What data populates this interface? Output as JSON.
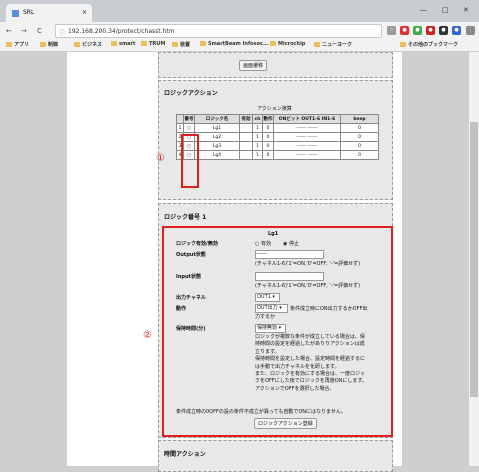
{
  "browser": {
    "tab_title": "SRL",
    "tab_close": "×",
    "url": "192.168.200.34/protect/chasst.htm",
    "window_controls": [
      "—",
      "□",
      "✕"
    ],
    "nav": [
      "←",
      "→",
      "C"
    ],
    "url_info": "ⓘ"
  },
  "bookmarks": [
    "アプリ",
    "制御",
    "ビジネス",
    "smart",
    "TRUM",
    "装置",
    "SmartBeam Infosoc...",
    "Microchip",
    "ニューヨーク"
  ],
  "bookmarks_right": "その他のブックマーク",
  "top_section": {
    "button": "画面遷移"
  },
  "logic_action": {
    "title": "ロジックアクション",
    "table_caption": "アクション演算",
    "headers": [
      "番号",
      "ロジック名",
      "有効",
      "ch",
      "動作",
      "ONビット OUT1-6 IN1-6",
      "keep"
    ],
    "rows": [
      {
        "idx": "1",
        "name": "Lg1",
        "en": "",
        "ch": "1",
        "act": "0",
        "bits": "------ ------",
        "keep": "0"
      },
      {
        "idx": "2",
        "name": "Lg2",
        "en": "",
        "ch": "1",
        "act": "0",
        "bits": "------ ------",
        "keep": "0"
      },
      {
        "idx": "3",
        "name": "Lg3",
        "en": "",
        "ch": "1",
        "act": "0",
        "bits": "------ ------",
        "keep": "0"
      },
      {
        "idx": "4",
        "name": "Lg4",
        "en": "",
        "ch": "1",
        "act": "0",
        "bits": "------ ------",
        "keep": "0"
      }
    ],
    "marker": "①"
  },
  "logic_number": {
    "title": "ロジック番号 1",
    "name": "Lg1",
    "enable_label": "ロジック有効/無効",
    "enable_opt1": "有効",
    "enable_opt2": "停止",
    "output_label": "Output状態",
    "output_value": "------",
    "output_help": "(チャネル1-6)'1'=ON,'0'=OFF, '-'=評価せず)",
    "input_label": "Input状態",
    "input_help": "(チャネル1-6)'1'=ON,'0'=OFF, '-'=評価せず)",
    "channel_label": "出力チャネル",
    "channel_value": "OUT1",
    "action_label": "動作",
    "action_value": "OUT出力",
    "action_help1": "条件成立時にON出力するかOFF出",
    "action_help2": "力するか",
    "hold_label": "保持時間(分)",
    "hold_value": "保持無効",
    "desc": [
      "ロジックが複数な条件が成立している場合は、保",
      "持時間の設定を経過したがありりアクションは成",
      "立ります。",
      "保持時間を設定した場合、設定時間を経過するに",
      "は手動で出力チャネルを化研します。",
      "また、ロジックを有効にする場合は、一度ロジッ",
      "クをOFFにした後でロジックを再度ONにします。",
      "アクションでOFFを選択した場合、",
      "条件成立時の0OFFの設の条件不成立が異っても自動でONにはなりません。"
    ],
    "register_button": "ロジックアクション登録",
    "marker": "②"
  },
  "next_section": {
    "title": "時間アクション"
  }
}
